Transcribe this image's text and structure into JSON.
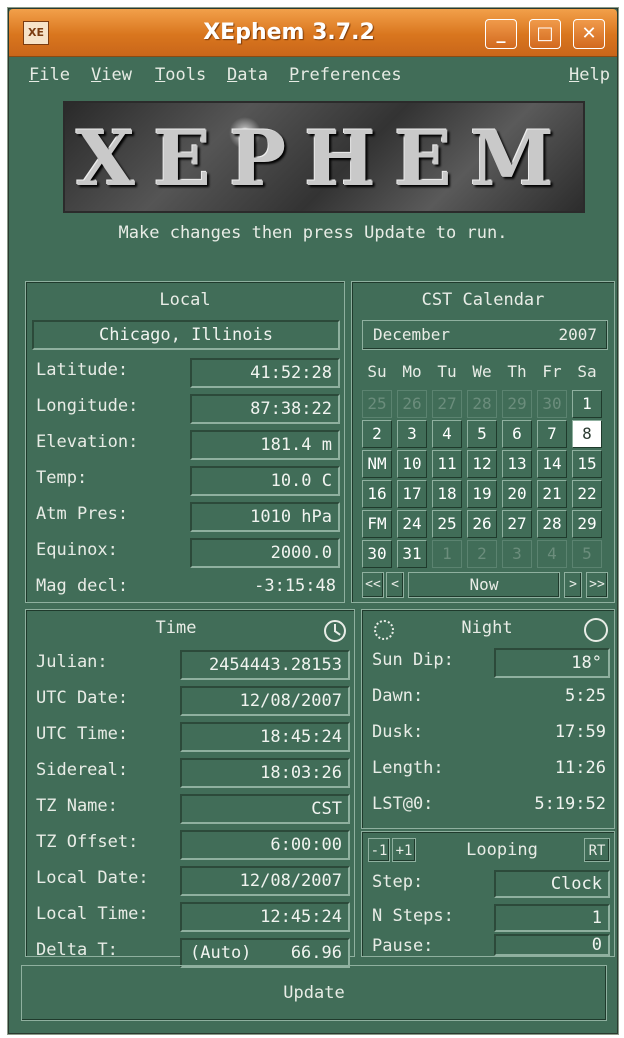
{
  "window": {
    "title": "XEphem 3.7.2",
    "icon_text": "XE",
    "controls": {
      "minimize": "_",
      "maximize": "□",
      "close": "✕"
    }
  },
  "menu": {
    "items": [
      {
        "label": "File"
      },
      {
        "label": "View"
      },
      {
        "label": "Tools"
      },
      {
        "label": "Data"
      },
      {
        "label": "Preferences"
      },
      {
        "label": "Help"
      }
    ]
  },
  "logo_text": "XEPHEM",
  "hint": "Make changes then press Update to run.",
  "local": {
    "title": "Local",
    "site": "Chicago, Illinois",
    "rows": [
      {
        "label": "Latitude:",
        "value": "41:52:28"
      },
      {
        "label": "Longitude:",
        "value": "87:38:22"
      },
      {
        "label": "Elevation:",
        "value": "181.4 m"
      },
      {
        "label": "Temp:",
        "value": "10.0 C"
      },
      {
        "label": "Atm Pres:",
        "value": "1010 hPa"
      },
      {
        "label": "Equinox:",
        "value": "2000.0"
      }
    ],
    "mag_decl": {
      "label": "Mag decl:",
      "value": "-3:15:48"
    }
  },
  "calendar": {
    "title": "CST Calendar",
    "month": "December",
    "year": "2007",
    "weekdays": [
      "Su",
      "Mo",
      "Tu",
      "We",
      "Th",
      "Fr",
      "Sa"
    ],
    "weeks": [
      [
        {
          "t": "25",
          "dim": true
        },
        {
          "t": "26",
          "dim": true
        },
        {
          "t": "27",
          "dim": true
        },
        {
          "t": "28",
          "dim": true
        },
        {
          "t": "29",
          "dim": true
        },
        {
          "t": "30",
          "dim": true
        },
        {
          "t": "1"
        }
      ],
      [
        {
          "t": "2"
        },
        {
          "t": "3"
        },
        {
          "t": "4"
        },
        {
          "t": "5"
        },
        {
          "t": "6"
        },
        {
          "t": "7"
        },
        {
          "t": "8",
          "sel": true
        }
      ],
      [
        {
          "t": "NM"
        },
        {
          "t": "10"
        },
        {
          "t": "11"
        },
        {
          "t": "12"
        },
        {
          "t": "13"
        },
        {
          "t": "14"
        },
        {
          "t": "15"
        }
      ],
      [
        {
          "t": "16"
        },
        {
          "t": "17"
        },
        {
          "t": "18"
        },
        {
          "t": "19"
        },
        {
          "t": "20"
        },
        {
          "t": "21"
        },
        {
          "t": "22"
        }
      ],
      [
        {
          "t": "FM"
        },
        {
          "t": "24"
        },
        {
          "t": "25"
        },
        {
          "t": "26"
        },
        {
          "t": "27"
        },
        {
          "t": "28"
        },
        {
          "t": "29"
        }
      ],
      [
        {
          "t": "30"
        },
        {
          "t": "31"
        },
        {
          "t": "1",
          "dim": true
        },
        {
          "t": "2",
          "dim": true
        },
        {
          "t": "3",
          "dim": true
        },
        {
          "t": "4",
          "dim": true
        },
        {
          "t": "5",
          "dim": true
        }
      ]
    ],
    "nav": {
      "prev_year": "<<",
      "prev_month": "<",
      "now": "Now",
      "next_month": ">",
      "next_year": ">>"
    }
  },
  "time": {
    "title": "Time",
    "rows": [
      {
        "label": "Julian:",
        "value": "2454443.28153"
      },
      {
        "label": "UTC Date:",
        "value": "12/08/2007"
      },
      {
        "label": "UTC Time:",
        "value": "18:45:24"
      },
      {
        "label": "Sidereal:",
        "value": "18:03:26"
      },
      {
        "label": "TZ Name:",
        "value": "CST"
      },
      {
        "label": "TZ Offset:",
        "value": "6:00:00"
      },
      {
        "label": "Local Date:",
        "value": "12/08/2007"
      },
      {
        "label": "Local Time:",
        "value": "12:45:24"
      },
      {
        "label": "Delta T:",
        "value_mode": "(Auto)",
        "value": "66.96"
      }
    ]
  },
  "night": {
    "title": "Night",
    "sun_dip": {
      "label": "Sun Dip:",
      "value": "18°"
    },
    "rows": [
      {
        "label": "Dawn:",
        "value": "5:25"
      },
      {
        "label": "Dusk:",
        "value": "17:59"
      },
      {
        "label": "Length:",
        "value": "11:26"
      },
      {
        "label": "LST@0:",
        "value": "5:19:52"
      }
    ]
  },
  "looping": {
    "title": "Looping",
    "minus": "-1",
    "plus": "+1",
    "rt": "RT",
    "rows": [
      {
        "label": "Step:",
        "value": "Clock"
      },
      {
        "label": "N Steps:",
        "value": "1"
      },
      {
        "label": "Pause:",
        "value": "0"
      }
    ]
  },
  "update_label": "Update"
}
